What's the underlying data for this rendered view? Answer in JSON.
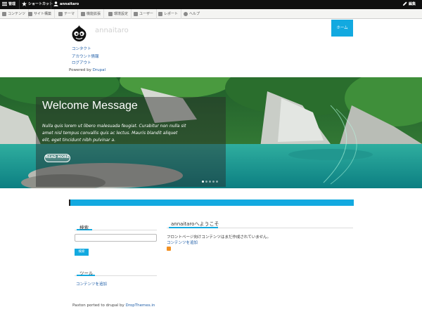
{
  "toolbar": {
    "manage": "管理",
    "shortcuts": "ショートカット",
    "user": "annaitaro",
    "edit": "編集"
  },
  "admin_menu": [
    {
      "label": "コンテンツ",
      "icon": "file-icon"
    },
    {
      "label": "サイト構築",
      "icon": "structure-icon"
    },
    {
      "label": "テーマ",
      "icon": "paint-icon"
    },
    {
      "label": "機能拡張",
      "icon": "puzzle-icon"
    },
    {
      "label": "環境設定",
      "icon": "wrench-icon"
    },
    {
      "label": "ユーザー",
      "icon": "people-icon"
    },
    {
      "label": "レポート",
      "icon": "chart-icon"
    },
    {
      "label": "ヘルプ",
      "icon": "help-icon"
    }
  ],
  "header": {
    "site_name": "annaitaro",
    "home_tab": "ホーム",
    "links": [
      "コンタクト",
      "アカウント情報",
      "ログアウト"
    ],
    "powered_prefix": "Powered by ",
    "powered_link": "Drupal"
  },
  "slider": {
    "title": "Welcome Message",
    "text": "Nulla quis lorem ut libero malesuada feugiat. Curabitur non nulla sit amet nisl tempus convallis quis ac lectus. Mauris blandit aliquet elit, eget tincidunt nibh pulvinar a.",
    "button": "READ MORE"
  },
  "sidebar": {
    "search_title": "検索",
    "search_button": "検索",
    "tools_title": "ツール",
    "tools_link": "コンテンツを追加"
  },
  "main": {
    "title": "annaitaroへようこそ",
    "message": "フロントページ向けコンテンツはまだ作成されていません。",
    "add_link": "コンテンツを追加"
  },
  "footer": {
    "prefix": "Paxton ported to drupal by ",
    "link": "DropThemes.in"
  },
  "colors": {
    "accent": "#12a9e0",
    "toolbar": "#0f0f0f"
  }
}
